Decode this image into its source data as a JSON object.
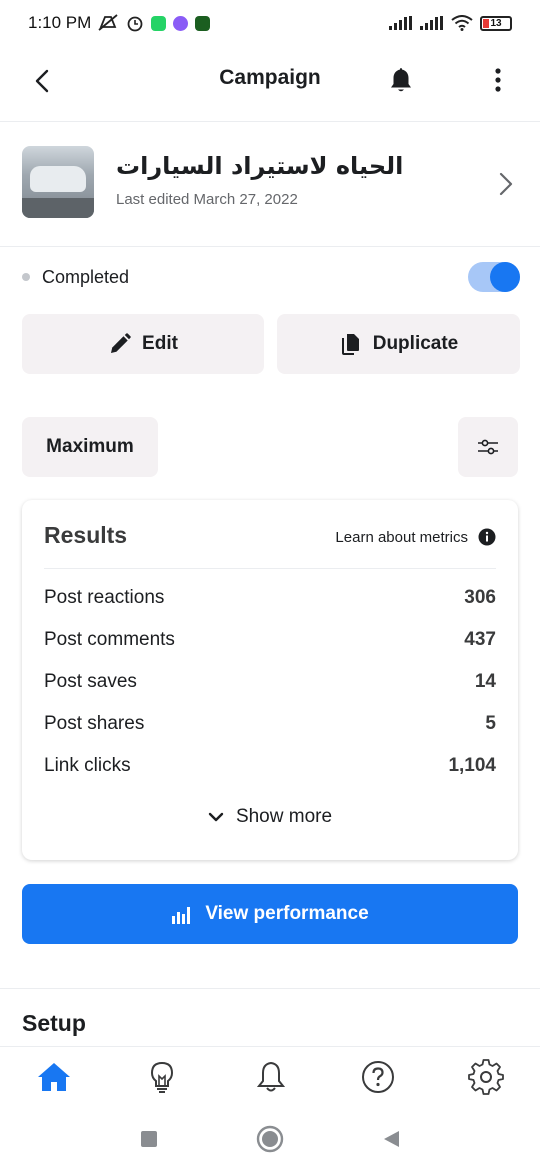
{
  "status_bar": {
    "time": "1:10 PM",
    "battery": "13"
  },
  "header": {
    "title": "Campaign",
    "icons": [
      "back-arrow-icon",
      "bell-icon",
      "more-vertical-icon"
    ]
  },
  "campaign": {
    "name": "الحياه لاستيراد السيارات",
    "last_edited": "Last edited March 27, 2022"
  },
  "status": {
    "label": "Completed",
    "toggle_on": true
  },
  "actions": {
    "edit_label": "Edit",
    "duplicate_label": "Duplicate"
  },
  "filter": {
    "selected": "Maximum"
  },
  "results": {
    "heading": "Results",
    "learn_label": "Learn about metrics",
    "metrics": [
      {
        "label": "Post reactions",
        "value": "306"
      },
      {
        "label": "Post comments",
        "value": "437"
      },
      {
        "label": "Post saves",
        "value": "14"
      },
      {
        "label": "Post shares",
        "value": "5"
      },
      {
        "label": "Link clicks",
        "value": "1,104"
      }
    ],
    "show_more_label": "Show more"
  },
  "view_performance_label": "View performance",
  "setup_heading": "Setup",
  "bottom_nav": [
    "home-icon",
    "lightbulb-icon",
    "bell-icon",
    "help-icon",
    "settings-icon"
  ],
  "colors": {
    "accent": "#1877f2",
    "button_bg": "#f4f1f3",
    "toggle_track": "#a7c7f7"
  }
}
